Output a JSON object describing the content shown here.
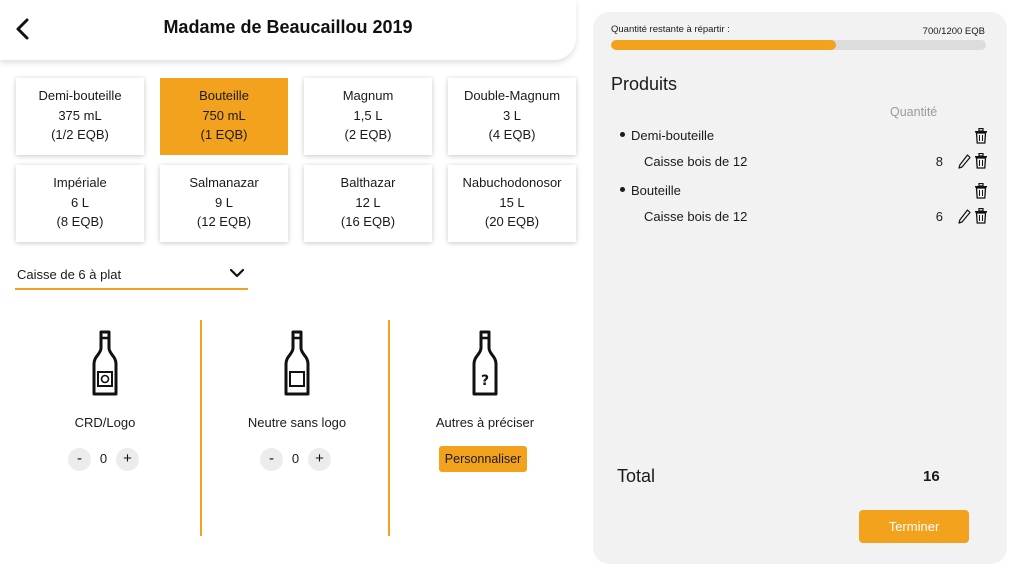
{
  "header": {
    "title": "Madame de Beaucaillou 2019",
    "back_icon": "chevron-left-icon"
  },
  "formats": [
    {
      "name": "Demi-bouteille",
      "volume": "375 mL",
      "eqb": "(1/2 EQB)",
      "selected": false
    },
    {
      "name": "Bouteille",
      "volume": "750 mL",
      "eqb": "(1 EQB)",
      "selected": true
    },
    {
      "name": "Magnum",
      "volume": "1,5 L",
      "eqb": "(2 EQB)",
      "selected": false
    },
    {
      "name": "Double-Magnum",
      "volume": "3 L",
      "eqb": "(4 EQB)",
      "selected": false
    },
    {
      "name": "Impériale",
      "volume": "6 L",
      "eqb": "(8 EQB)",
      "selected": false
    },
    {
      "name": "Salmanazar",
      "volume": "9 L",
      "eqb": "(12 EQB)",
      "selected": false
    },
    {
      "name": "Balthazar",
      "volume": "12 L",
      "eqb": "(16 EQB)",
      "selected": false
    },
    {
      "name": "Nabuchodonosor",
      "volume": "15 L",
      "eqb": "(20 EQB)",
      "selected": false
    }
  ],
  "case_select": {
    "value": "Caisse de 6 à plat",
    "icon": "chevron-down-icon"
  },
  "options": [
    {
      "label": "CRD/Logo",
      "icon": "bottle-logo-icon",
      "quantity": "0",
      "minus": "-",
      "plus": "+"
    },
    {
      "label": "Neutre sans logo",
      "icon": "bottle-blank-icon",
      "quantity": "0",
      "minus": "-",
      "plus": "+"
    },
    {
      "label": "Autres à préciser",
      "icon": "bottle-question-icon",
      "button": "Personnaliser"
    }
  ],
  "summary": {
    "remaining_label": "Quantité restante à répartir :",
    "remaining_value": "700/1200 EQB",
    "remaining_fill": 0.6,
    "products_title": "Produits",
    "quantity_header": "Quantité",
    "products": [
      {
        "name": "Demi-bouteille",
        "case": "Caisse bois de 12",
        "quantity": "8"
      },
      {
        "name": "Bouteille",
        "case": "Caisse bois de 12",
        "quantity": "6"
      }
    ],
    "total_label": "Total",
    "total_value": "16",
    "finish_label": "Terminer"
  },
  "colors": {
    "accent": "#f3a21e",
    "panel_bg": "#f2f2f2",
    "muted_text": "#9a9a9a"
  }
}
